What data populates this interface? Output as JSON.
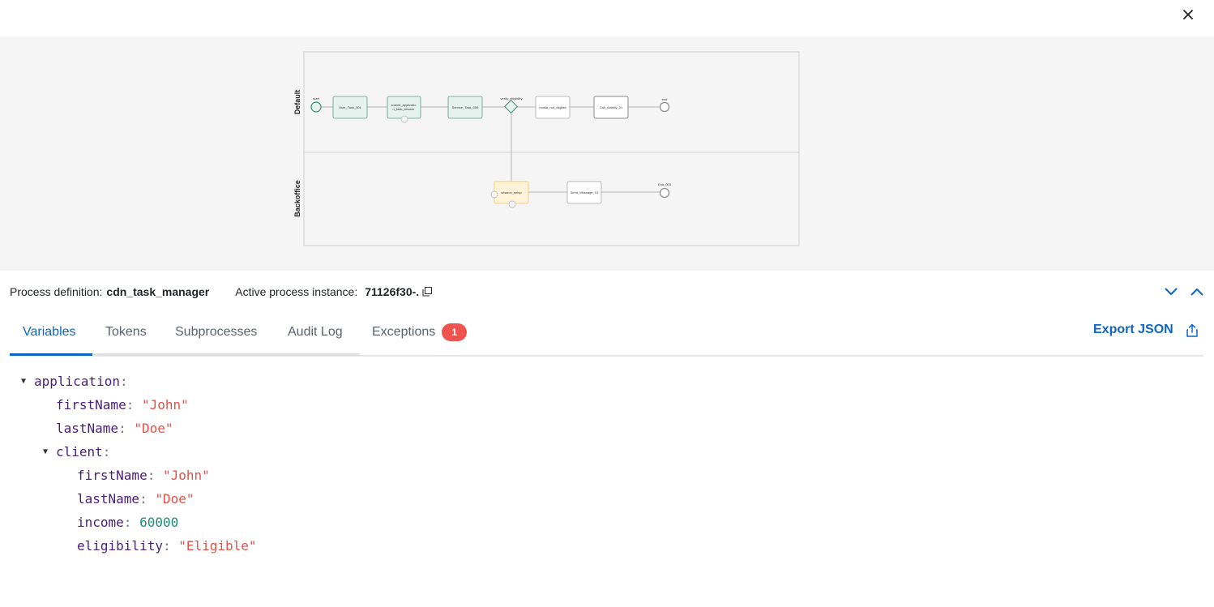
{
  "diagram": {
    "lanes": [
      "Default",
      "Backoffice"
    ],
    "nodes": {
      "start": "start",
      "user_task": "User_Task_001",
      "submit_task": "submit_applicatio",
      "submit_task_line2": "n_task_answer",
      "service_task": "Service_Task_006",
      "gateway": "verify_eligibility",
      "modal": "modal_not_eligible",
      "call_activity": "Call_Activity_01",
      "end": "end",
      "session": "session_setup",
      "send_message": "Send_Message_01",
      "end2": "End_003"
    }
  },
  "info": {
    "definition_label": "Process definition:",
    "definition_value": "cdn_task_manager",
    "instance_label": "Active process instance:",
    "instance_value": "71126f30-."
  },
  "tabs": [
    {
      "label": "Variables"
    },
    {
      "label": "Tokens"
    },
    {
      "label": "Subprocesses"
    },
    {
      "label": "Audit Log"
    },
    {
      "label": "Exceptions",
      "badge": "1"
    }
  ],
  "export_label": "Export JSON",
  "variables": {
    "application_key": "application",
    "app_firstName_key": "firstName",
    "app_firstName_val": "\"John\"",
    "app_lastName_key": "lastName",
    "app_lastName_val": "\"Doe\"",
    "client_key": "client",
    "client_firstName_key": "firstName",
    "client_firstName_val": "\"John\"",
    "client_lastName_key": "lastName",
    "client_lastName_val": "\"Doe\"",
    "client_income_key": "income",
    "client_income_val": "60000",
    "client_eligibility_key": "eligibility",
    "client_eligibility_val": "\"Eligible\""
  },
  "colors": {
    "accent": "#0b66c3",
    "badge": "#ef5350",
    "completed_task": "#e6f2ee",
    "active_task": "#fff3d9"
  }
}
